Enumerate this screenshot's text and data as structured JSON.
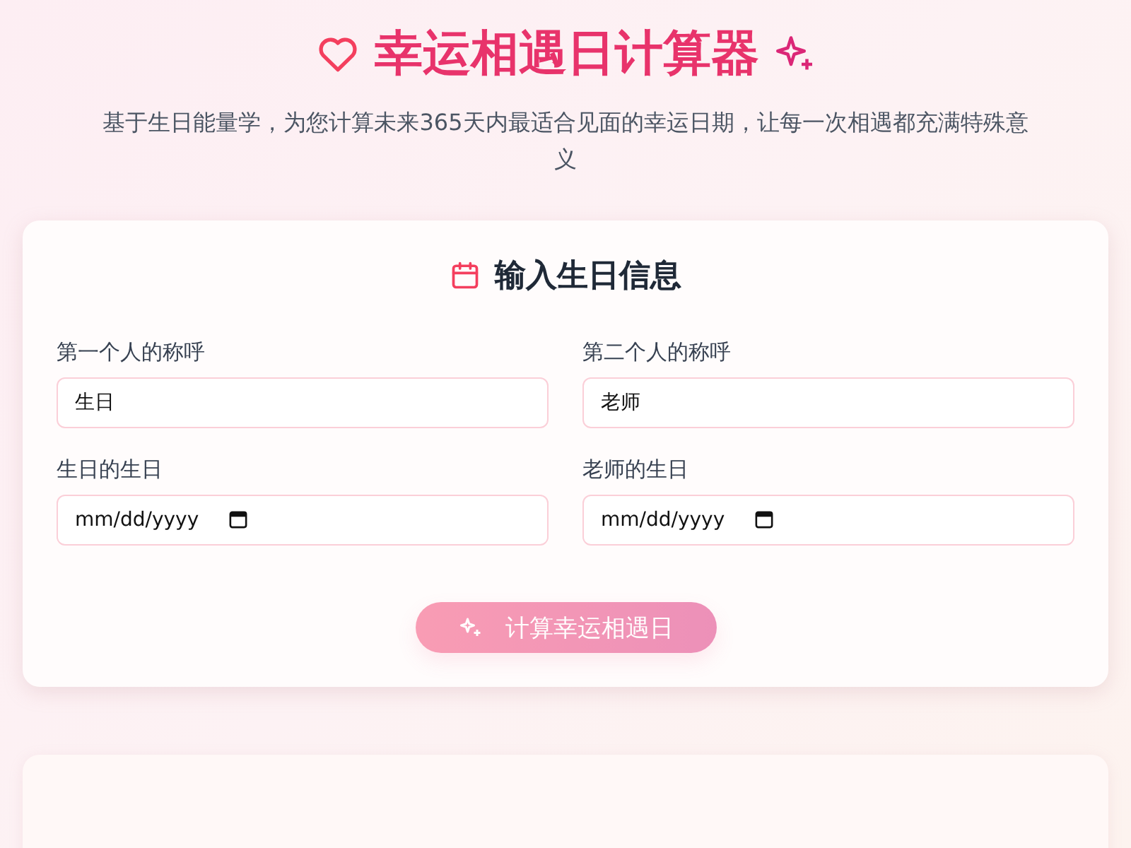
{
  "header": {
    "title": "幸运相遇日计算器",
    "subtitle": "基于生日能量学，为您计算未来365天内最适合见面的幸运日期，让每一次相遇都充满特殊意义"
  },
  "form": {
    "title": "输入生日信息",
    "fields": [
      {
        "kind": "text",
        "label": "第一个人的称呼",
        "value": "生日"
      },
      {
        "kind": "text",
        "label": "第二个人的称呼",
        "value": "老师"
      },
      {
        "kind": "date",
        "label": "生日的生日",
        "placeholder": "mm/dd/yyyy"
      },
      {
        "kind": "date",
        "label": "老师的生日",
        "placeholder": "mm/dd/yyyy"
      }
    ],
    "button": {
      "label": "计算幸运相遇日",
      "disabled": true
    }
  },
  "results": {
    "kind": "empty-card"
  }
}
